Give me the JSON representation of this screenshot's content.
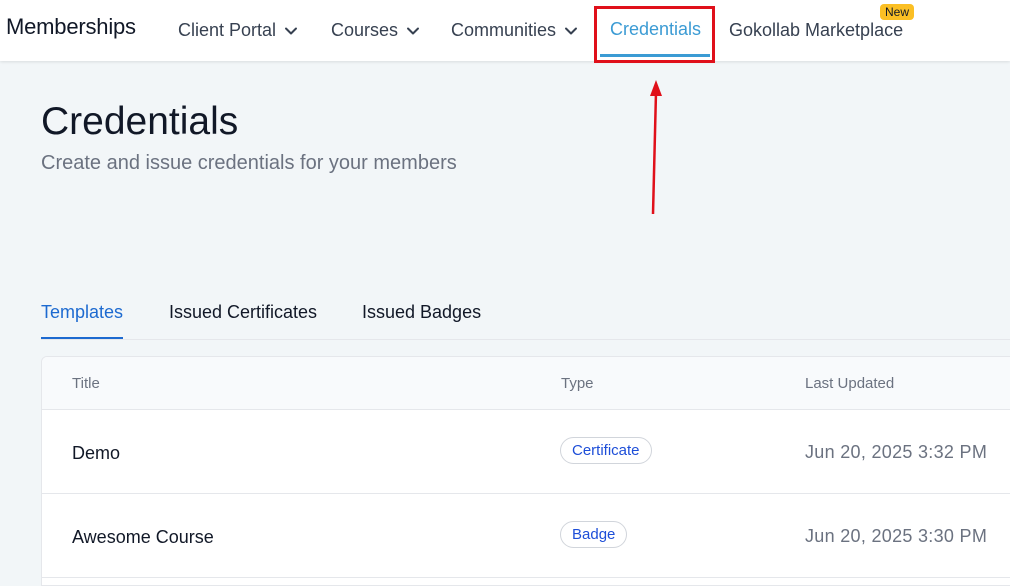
{
  "nav": {
    "brand": "Memberships",
    "items": {
      "client_portal": "Client Portal",
      "courses": "Courses",
      "communities": "Communities",
      "credentials": "Credentials",
      "marketplace": "Gokollab Marketplace"
    },
    "new_badge": "New",
    "active": "credentials",
    "accent_color": "#3b9bd4",
    "highlight_color": "#e0101a"
  },
  "header": {
    "title": "Credentials",
    "subtitle": "Create and issue credentials for your members"
  },
  "tabs": {
    "templates": "Templates",
    "issued_certificates": "Issued Certificates",
    "issued_badges": "Issued Badges",
    "active": "templates"
  },
  "table": {
    "columns": {
      "title": "Title",
      "type": "Type",
      "last_updated": "Last Updated"
    },
    "rows": [
      {
        "title": "Demo",
        "type": "Certificate",
        "last_updated": "Jun 20, 2025 3:32 PM"
      },
      {
        "title": "Awesome Course",
        "type": "Badge",
        "last_updated": "Jun 20, 2025 3:30 PM"
      }
    ]
  }
}
